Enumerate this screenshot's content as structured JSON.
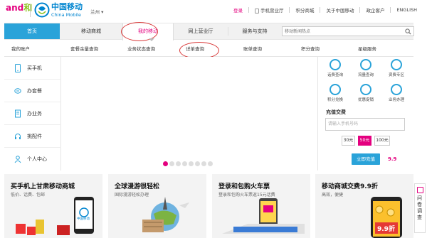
{
  "header": {
    "logo_and": "and",
    "logo_he": "和",
    "brand_cn": "中国移动",
    "brand_en": "China Mobile",
    "city": "兰州",
    "topnav": {
      "login": "登录",
      "mobile_hall": "手机营业厅",
      "points_mall": "积分商城",
      "about": "关于中国移动",
      "enterprise": "政企客户",
      "english": "ENGLISH"
    }
  },
  "mainnav": {
    "tabs": [
      {
        "label": "首页"
      },
      {
        "label": "移动商城"
      },
      {
        "label": "我的移动"
      },
      {
        "label": "网上营业厅"
      },
      {
        "label": "服务与支持"
      }
    ],
    "search_placeholder": "移动新闻热点"
  },
  "subnav": {
    "items": [
      {
        "label": "我的账户"
      },
      {
        "label": "套餐余量查询"
      },
      {
        "label": "业务状态查询"
      },
      {
        "label": "详单查询"
      },
      {
        "label": "账单查询"
      },
      {
        "label": "积分查询"
      },
      {
        "label": "星级服务"
      }
    ]
  },
  "sidemenu": {
    "items": [
      {
        "label": "买手机"
      },
      {
        "label": "办套餐"
      },
      {
        "label": "办业务"
      },
      {
        "label": "挑配件"
      },
      {
        "label": "个人中心"
      }
    ]
  },
  "rpanel": {
    "services": [
      {
        "label": "话费查询"
      },
      {
        "label": "流量查询"
      },
      {
        "label": "资费专区"
      },
      {
        "label": "积分兑换"
      },
      {
        "label": "优惠促销"
      },
      {
        "label": "业务办理"
      }
    ],
    "recharge_title": "充值交费",
    "phone_placeholder": "请输入手机号码",
    "amounts": [
      "30元",
      "50元",
      "100元"
    ],
    "pay_button": "立即充值",
    "discount": "9.9"
  },
  "cards": [
    {
      "title": "买手机上甘肃移动商城",
      "subtitle": "低价、话费、包邮"
    },
    {
      "title": "全球漫游很轻松",
      "subtitle": "国际漫游轻松办理"
    },
    {
      "title": "登录和包购火车票",
      "subtitle": "登录和包购火车票返15元话费"
    },
    {
      "title": "移动商城交费9.9折",
      "subtitle": "高效，便捷"
    }
  ],
  "card_extra": {
    "phone_brand": "中国移动",
    "price_tag": "9.9折"
  },
  "float_tab": {
    "label": "问卷调查"
  },
  "colors": {
    "brand_blue": "#0085d0",
    "accent_pink": "#e4007f",
    "nav_blue": "#2aa3d9"
  }
}
